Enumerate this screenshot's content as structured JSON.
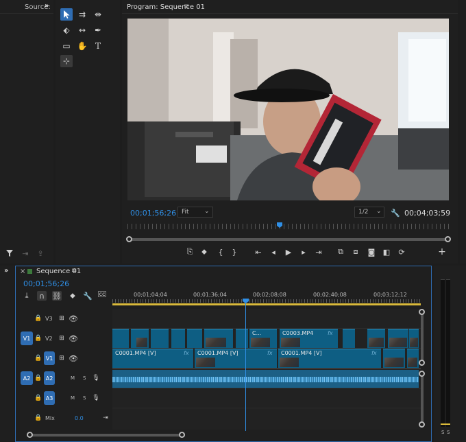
{
  "source_panel": {
    "title": "Source:",
    "more": "»"
  },
  "program_panel": {
    "title": "Program: Sequence 01",
    "menu": "≡",
    "timecode_current": "00;01;56;26",
    "zoom": "Fit",
    "resolution": "1/2",
    "timecode_total": "00;04;03;59",
    "playhead_fraction": 0.475
  },
  "timeline": {
    "tab_close": "×",
    "title": "Sequence 01",
    "menu": "≡",
    "timecode": "00;01;56;26",
    "ruler_ticks": [
      "00;01;04;04",
      "00;01;36;04",
      "00;02;08;08",
      "00;02;40;08",
      "00;03;12;12"
    ],
    "tracks": [
      {
        "label": "V3",
        "source": ""
      },
      {
        "label": "V2",
        "source": "V1"
      },
      {
        "label": "V1",
        "target": "V1"
      },
      {
        "label": "A2",
        "source": "A2",
        "m": "M",
        "s": "S"
      },
      {
        "label": "A3",
        "m": "M",
        "s": "S"
      }
    ],
    "clips": {
      "v2_c": "C...",
      "v2_c3": "C0003.MP4",
      "v1_a": "C0001.MP4 [V]",
      "v1_b": "C0001.MP4 [V]",
      "v1_c": "C0001.MP4 [V]",
      "fx": "fx"
    },
    "mix": {
      "label": "Mix",
      "value": "0.0"
    }
  },
  "meter": {
    "labels": [
      "S",
      "S"
    ]
  }
}
